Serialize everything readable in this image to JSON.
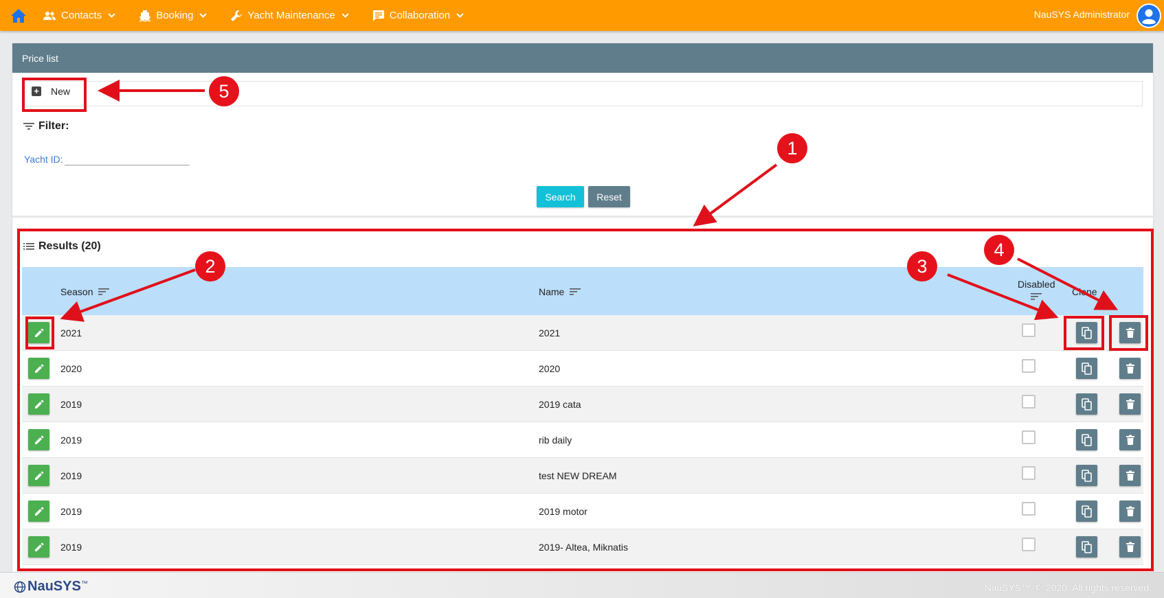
{
  "nav": {
    "items": [
      {
        "label": "Contacts",
        "icon": "people-icon"
      },
      {
        "label": "Booking",
        "icon": "boat-icon"
      },
      {
        "label": "Yacht Maintenance",
        "icon": "wrench-icon"
      },
      {
        "label": "Collaboration",
        "icon": "chat-icon"
      }
    ],
    "user": "NauSYS Administrator"
  },
  "panel": {
    "title": "Price list"
  },
  "toolbar": {
    "new_label": "New"
  },
  "filter": {
    "title": "Filter:",
    "yacht_label": "Yacht ID:",
    "yacht_value": "",
    "search_label": "Search",
    "reset_label": "Reset"
  },
  "results": {
    "title": "Results (20)",
    "columns": {
      "season": "Season",
      "name": "Name",
      "disabled": "Disabled",
      "clone": "Clone"
    },
    "rows": [
      {
        "season": "2021",
        "name": "2021",
        "disabled": false
      },
      {
        "season": "2020",
        "name": "2020",
        "disabled": false
      },
      {
        "season": "2019",
        "name": "2019 cata",
        "disabled": false
      },
      {
        "season": "2019",
        "name": "rib daily",
        "disabled": false
      },
      {
        "season": "2019",
        "name": "test NEW DREAM",
        "disabled": false
      },
      {
        "season": "2019",
        "name": "2019 motor",
        "disabled": false
      },
      {
        "season": "2019",
        "name": "2019- Altea, Miknatis",
        "disabled": false
      }
    ]
  },
  "footer": {
    "brand": "NauSYS",
    "trademark": "™",
    "copyright": "NauSYS™ Ⓒ 2020. All rights reserved."
  },
  "annotations": [
    "1",
    "2",
    "3",
    "4",
    "5"
  ],
  "colors": {
    "nav": "#ff9a00",
    "header": "#607d8b",
    "edit": "#4caf50",
    "search": "#13c0d7",
    "table_head": "#bbdefb",
    "annotation": "#e5121b"
  }
}
